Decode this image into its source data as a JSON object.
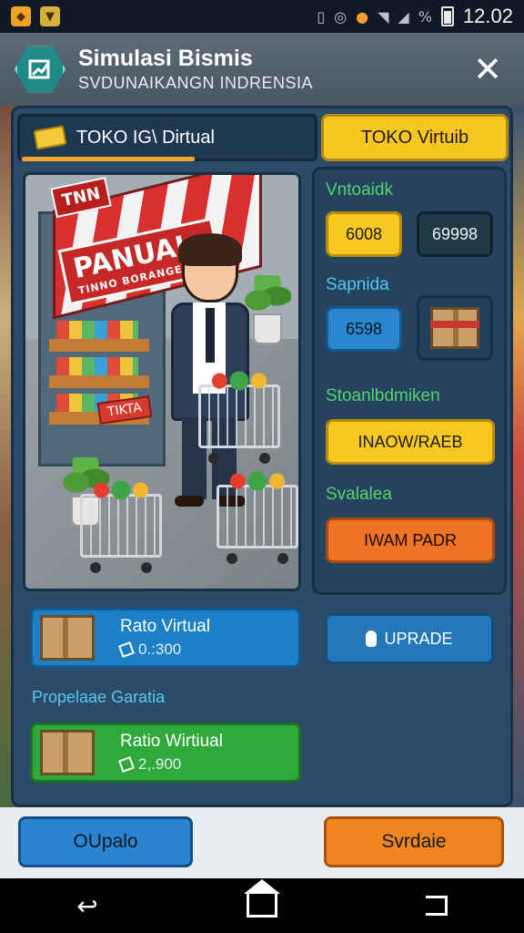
{
  "status_bar": {
    "time": "12.02",
    "icons": [
      "package-icon",
      "ticket-icon",
      "vibrate-icon",
      "sync-icon",
      "location-icon",
      "wifi-icon",
      "signal-icon",
      "battery-icon"
    ],
    "signal_label": "%"
  },
  "header": {
    "title": "Simulasi Bismis",
    "subtitle": "SVDUNAIKANGN INDRENSIA",
    "logo_icon": "chart-up-icon",
    "close_icon": "close-icon"
  },
  "tabs": {
    "left_label": "TOKO IG\\ Dirtual",
    "right_label": "TOKO Virtuib"
  },
  "scene": {
    "top_sign": "TNN",
    "awning_sign": "PANUAL",
    "awning_sub": "TINNO BORANGESAM",
    "price_sign": "TIKTA"
  },
  "right_panel": {
    "section1_label": "Vntoaidk",
    "btn_yellow_value": "6008",
    "btn_dark_value": "69998",
    "section2_label": "Sapnida",
    "btn_blue_value": "6598",
    "box_icon": "gift-box-icon",
    "section3_label": "Stoanlbdmiken",
    "section3_button": "INAOW/RAEB",
    "section4_label": "Svalalea",
    "section4_button": "IWAM PADR"
  },
  "cards": [
    {
      "name": "Rato Virtual",
      "price": "0.:300",
      "color": "blue",
      "icon": "cardboard-box-icon"
    },
    {
      "name": "Ratio Wirtiual",
      "price": "2,.900",
      "color": "green",
      "icon": "coin-box-icon"
    }
  ],
  "upgrade_button": "UPRADE",
  "list_label": "Propelaae Garatia",
  "footer": {
    "left_button": "OUpalo",
    "right_button": "Svrdaie"
  },
  "nav": {
    "back_icon": "back-icon",
    "home_icon": "home-icon",
    "recent_icon": "recent-apps-icon"
  }
}
